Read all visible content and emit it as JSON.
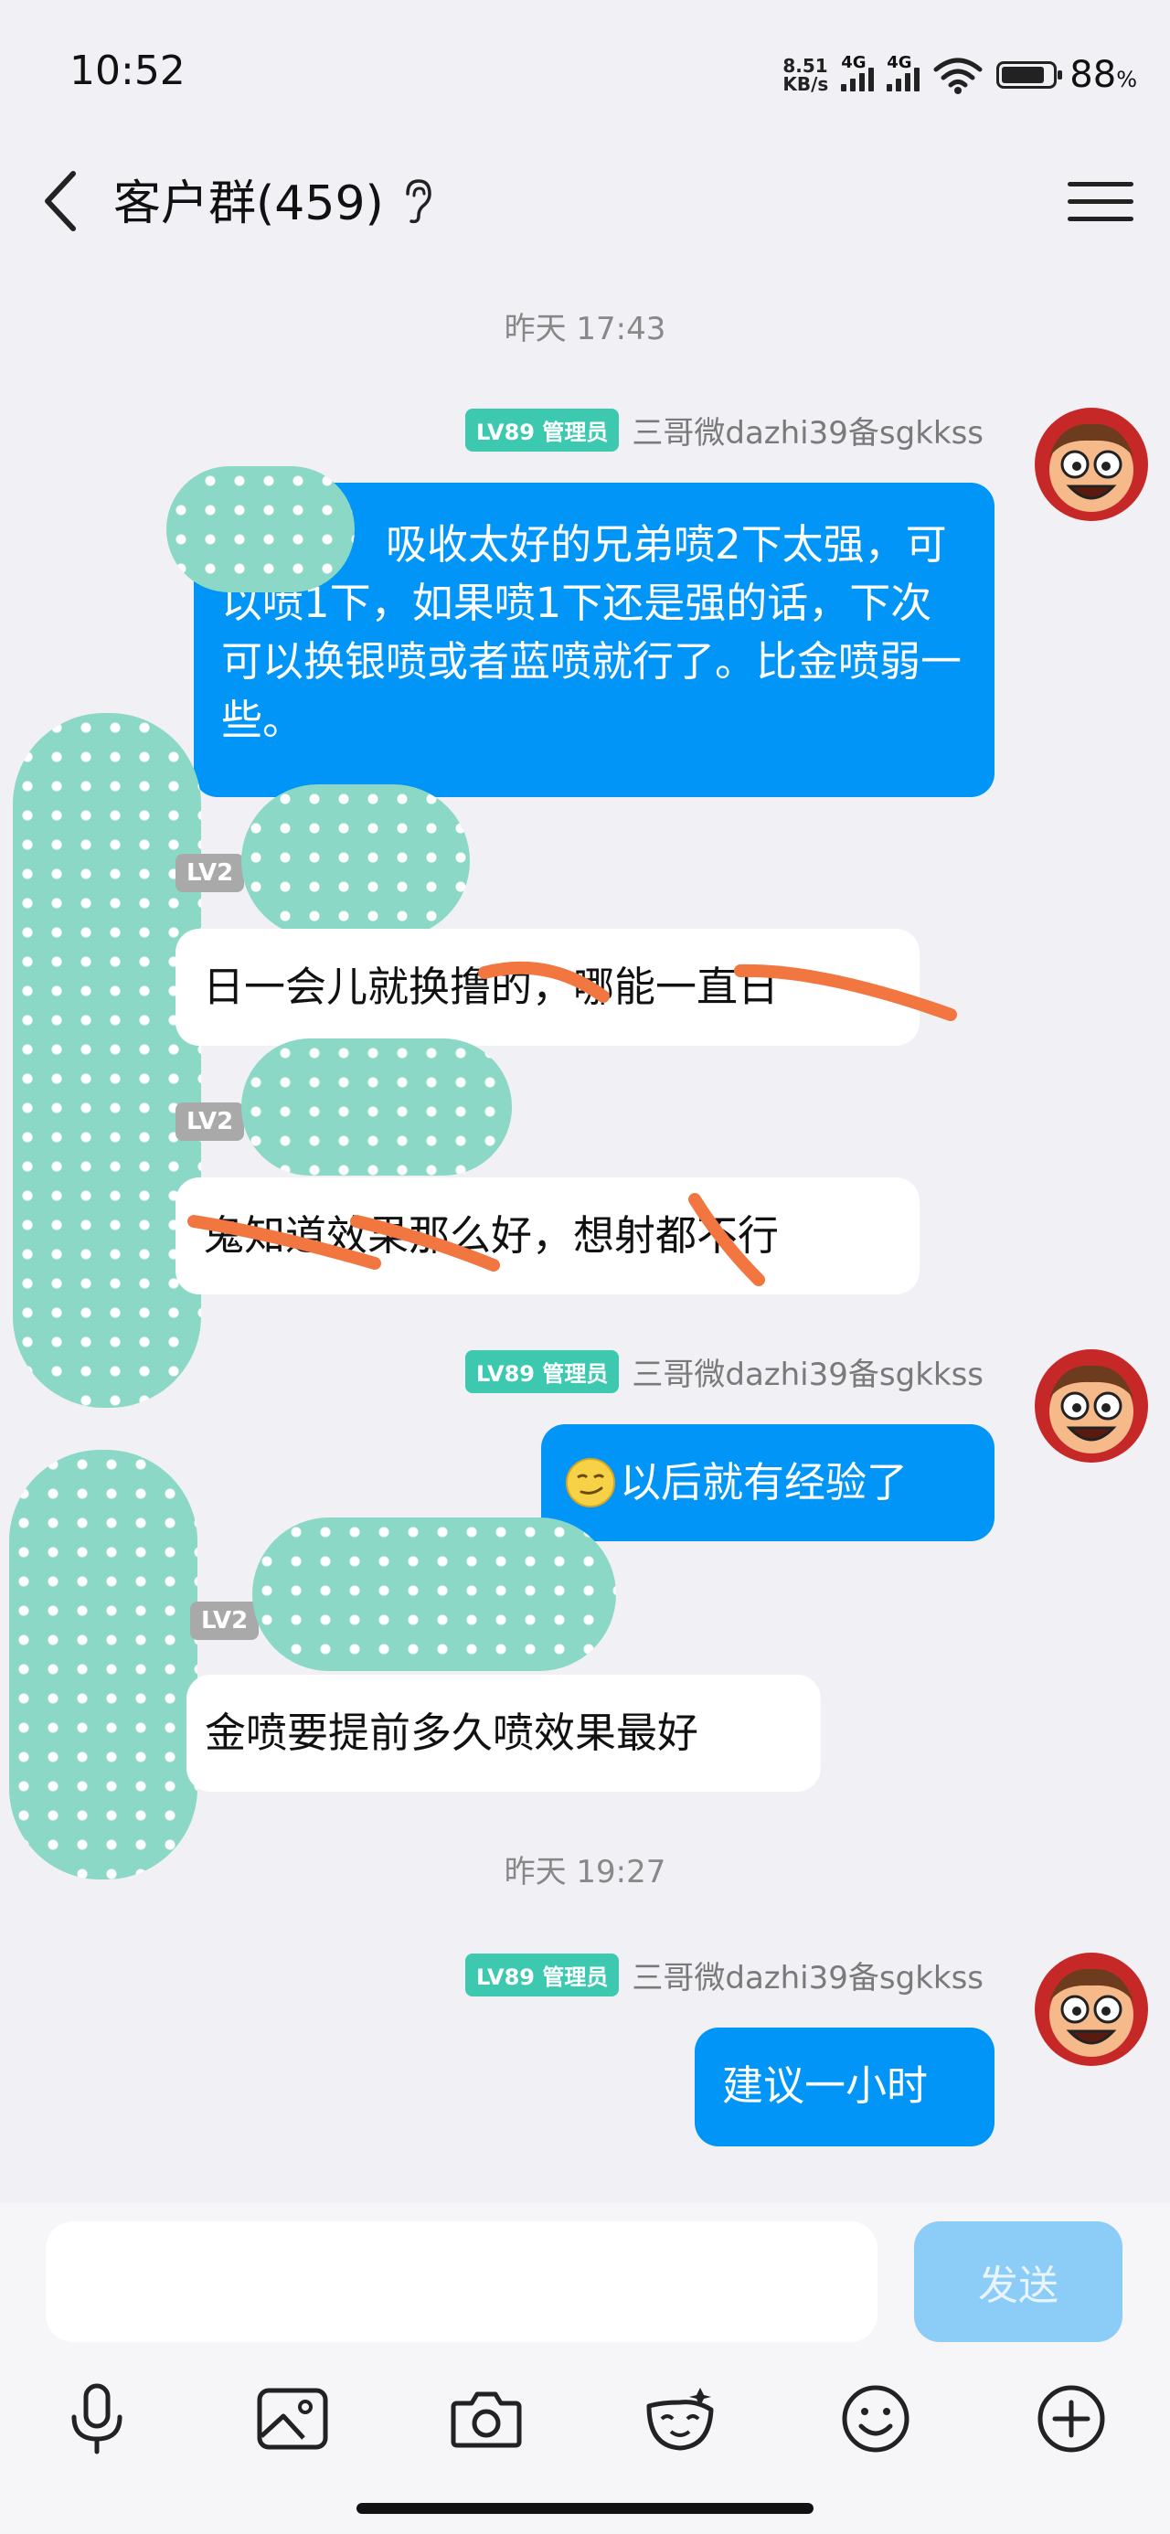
{
  "status_bar": {
    "time": "10:52",
    "net_speed_value": "8.51",
    "net_speed_unit": "KB/s",
    "network_1": "4G",
    "network_2": "4G",
    "battery_percent": "88",
    "battery_unit": "%"
  },
  "header": {
    "title": "客户群(459)"
  },
  "messages": [
    {
      "type": "timestamp",
      "text": "昨天 17:43"
    },
    {
      "type": "outgoing",
      "badge": "LV89 管理员",
      "sender": "三哥微dazhi39备sgkkss",
      "text": "吸收太好的兄弟喷2下太强，可以喷1下，如果喷1下还是强的话，下次可以换银喷或者蓝喷就行了。比金喷弱一些。"
    },
    {
      "type": "incoming",
      "badge": "LV2",
      "text": "日一会儿就换撸的，哪能一直日"
    },
    {
      "type": "incoming",
      "badge": "LV2",
      "text": "鬼知道效果那么好，想射都不行"
    },
    {
      "type": "outgoing",
      "badge": "LV89 管理员",
      "sender": "三哥微dazhi39备sgkkss",
      "text": "以后就有经验了"
    },
    {
      "type": "incoming",
      "badge": "LV2",
      "text": "金喷要提前多久喷效果最好"
    },
    {
      "type": "timestamp",
      "text": "昨天 19:27"
    },
    {
      "type": "outgoing",
      "badge": "LV89 管理员",
      "sender": "三哥微dazhi39备sgkkss",
      "text": "建议一小时"
    }
  ],
  "input": {
    "placeholder": "",
    "send_label": "发送"
  },
  "toolbar_icons": [
    "microphone-icon",
    "image-icon",
    "camera-icon",
    "sticker-icon",
    "emoji-icon",
    "plus-icon"
  ],
  "colors": {
    "outgoing_bubble": "#0095f6",
    "incoming_bubble": "#ffffff",
    "admin_badge": "#3dc9b0",
    "level_badge": "#a9a9a9",
    "send_button_disabled": "#8ccdf7",
    "background": "#f0f0f5"
  }
}
